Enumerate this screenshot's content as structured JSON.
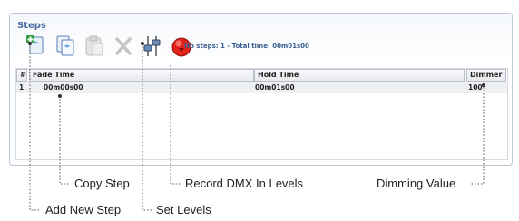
{
  "panel": {
    "title": "Steps"
  },
  "toolbar": {
    "stats": "Nb steps: 1 - Total time: 00m01s00"
  },
  "grid": {
    "columns": [
      "#",
      "Fade Time",
      "Hold Time",
      "Dimmer"
    ],
    "rows": [
      {
        "num": "1",
        "fade": "00m00s00",
        "hold": "00m01s00",
        "dimmer": "100"
      }
    ]
  },
  "callouts": {
    "copy_step": "Copy Step",
    "record_dmx": "Record DMX In Levels",
    "dimming_value": "Dimming Value",
    "add_new_step": "Add New Step",
    "set_levels": "Set Levels"
  },
  "colors": {
    "title": "#4b6fa0",
    "record": "#e0241b",
    "callout_line": "#555555"
  }
}
